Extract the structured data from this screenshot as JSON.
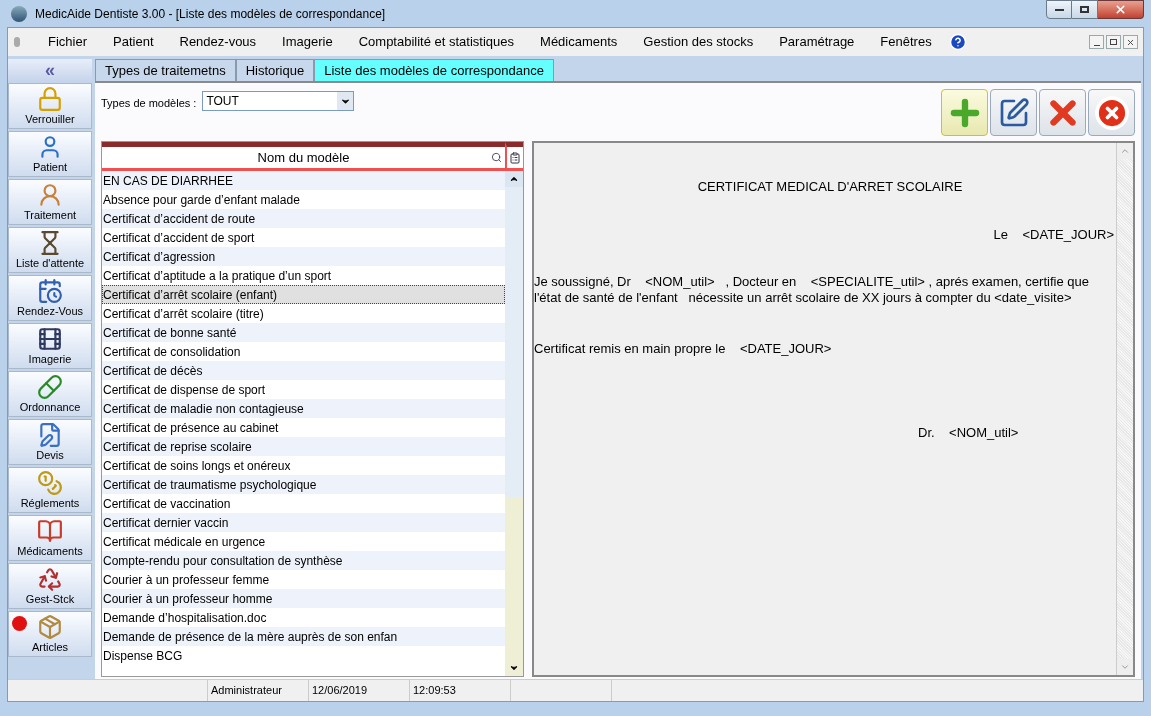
{
  "window": {
    "title": "MedicAide Dentiste 3.00  - [Liste des modèles de correspondance]"
  },
  "menu": [
    "Fichier",
    "Patient",
    "Rendez-vous",
    "Imagerie",
    "Comptabilité et statistiques",
    "Médicaments",
    "Gestion des stocks",
    "Paramétrage",
    "Fenêtres"
  ],
  "sidebar": {
    "collapse_icon": "«",
    "items": [
      {
        "label": "Verrouiller",
        "alert": false
      },
      {
        "label": "Patient",
        "alert": false
      },
      {
        "label": "Traitement",
        "alert": false
      },
      {
        "label": "Liste d'attente",
        "alert": false
      },
      {
        "label": "Rendez-Vous",
        "alert": false
      },
      {
        "label": "Imagerie",
        "alert": false
      },
      {
        "label": "Ordonnance",
        "alert": false
      },
      {
        "label": "Devis",
        "alert": false
      },
      {
        "label": "Réglements",
        "alert": false
      },
      {
        "label": "Médicaments",
        "alert": false
      },
      {
        "label": "Gest-Stck",
        "alert": false
      },
      {
        "label": "Articles",
        "alert": true
      }
    ]
  },
  "tabs": [
    {
      "label": "Types de traitemetns",
      "selected": false
    },
    {
      "label": "Historique",
      "selected": false
    },
    {
      "label": "Liste des modèles de correspondance",
      "selected": true
    }
  ],
  "filter": {
    "label": "Types de modèles :",
    "value": "TOUT"
  },
  "toolbar_buttons": [
    {
      "kind": "add",
      "highlighted": true
    },
    {
      "kind": "edit",
      "highlighted": false
    },
    {
      "kind": "delete",
      "highlighted": false
    },
    {
      "kind": "close",
      "highlighted": false
    }
  ],
  "table": {
    "column": "Nom du modèle",
    "rows": [
      {
        "name": "EN CAS DE DIARRHEE",
        "selected": false
      },
      {
        "name": "Absence pour garde d’enfant malade",
        "selected": false
      },
      {
        "name": "Certificat d’accident de route",
        "selected": false
      },
      {
        "name": "Certificat d’accident de sport",
        "selected": false
      },
      {
        "name": "Certificat d’agression",
        "selected": false
      },
      {
        "name": "Certificat d’aptitude a la pratique d’un sport",
        "selected": false
      },
      {
        "name": "Certificat d’arrêt scolaire (enfant)",
        "selected": true
      },
      {
        "name": "Certificat d’arrêt scolaire (titre)",
        "selected": false
      },
      {
        "name": "Certificat de bonne santé",
        "selected": false
      },
      {
        "name": "Certificat de consolidation",
        "selected": false
      },
      {
        "name": "Certificat de décès",
        "selected": false
      },
      {
        "name": "Certificat de dispense de sport",
        "selected": false
      },
      {
        "name": "Certificat de maladie non contagieuse",
        "selected": false
      },
      {
        "name": "Certificat de présence au cabinet",
        "selected": false
      },
      {
        "name": "Certificat de reprise scolaire",
        "selected": false
      },
      {
        "name": "Certificat de soins longs et onéreux",
        "selected": false
      },
      {
        "name": "Certificat de traumatisme psychologique",
        "selected": false
      },
      {
        "name": "Certificat de vaccination",
        "selected": false
      },
      {
        "name": "Certificat dernier vaccin",
        "selected": false
      },
      {
        "name": "Certificat médicale en urgence",
        "selected": false
      },
      {
        "name": "Compte-rendu pour consultation de synthèse",
        "selected": false
      },
      {
        "name": "Courier à un professeur femme",
        "selected": false
      },
      {
        "name": "Courier à un professeur homme",
        "selected": false
      },
      {
        "name": "Demande d’hospitalisation.doc",
        "selected": false
      },
      {
        "name": "Demande de présence de la mère auprès de son enfan",
        "selected": false
      },
      {
        "name": "Dispense BCG",
        "selected": false
      }
    ]
  },
  "preview": {
    "title": "CERTIFICAT MEDICAL D'ARRET SCOLAIRE",
    "date_line": "Le    <DATE_JOUR>",
    "body": "Je soussigné, Dr    <NOM_util>   , Docteur en    <SPECIALITE_util> , aprés examen, certifie que l'état de santé de l'enfant   nécessite un arrêt scolaire de XX jours à compter du <date_visite>",
    "remise": "Certificat remis en main propre le    <DATE_JOUR>",
    "signature": "Dr.    <NOM_util>"
  },
  "status_bar": [
    "Administrateur",
    "12/06/2019",
    "12:09:53"
  ]
}
